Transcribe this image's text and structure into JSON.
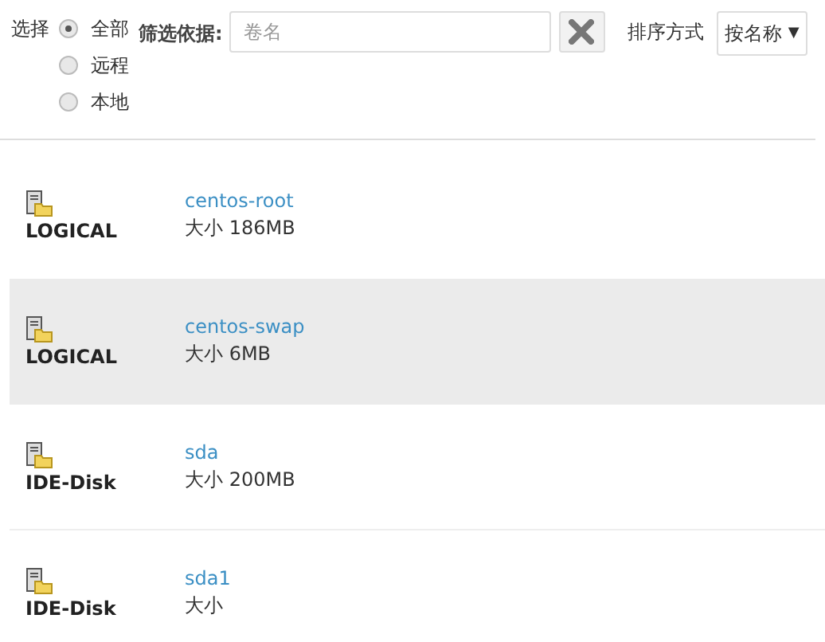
{
  "filter_bar": {
    "choose_label": "选择",
    "options": [
      {
        "label": "全部",
        "selected": true
      },
      {
        "label": "远程",
        "selected": false
      },
      {
        "label": "本地",
        "selected": false
      }
    ],
    "filter_label": "筛选依据:",
    "search": {
      "placeholder": "卷名"
    },
    "sort_label": "排序方式",
    "sort": {
      "value": "按名称",
      "caret": "▼"
    }
  },
  "volumes": [
    {
      "type": "LOGICAL",
      "name": "centos-root",
      "size": "大小 186MB",
      "selected": false
    },
    {
      "type": "LOGICAL",
      "name": "centos-swap",
      "size": "大小 6MB",
      "selected": true
    },
    {
      "type": "IDE-Disk",
      "name": "sda",
      "size": "大小 200MB",
      "selected": false
    },
    {
      "type": "IDE-Disk",
      "name": "sda1",
      "size": "大小",
      "selected": false
    }
  ]
}
